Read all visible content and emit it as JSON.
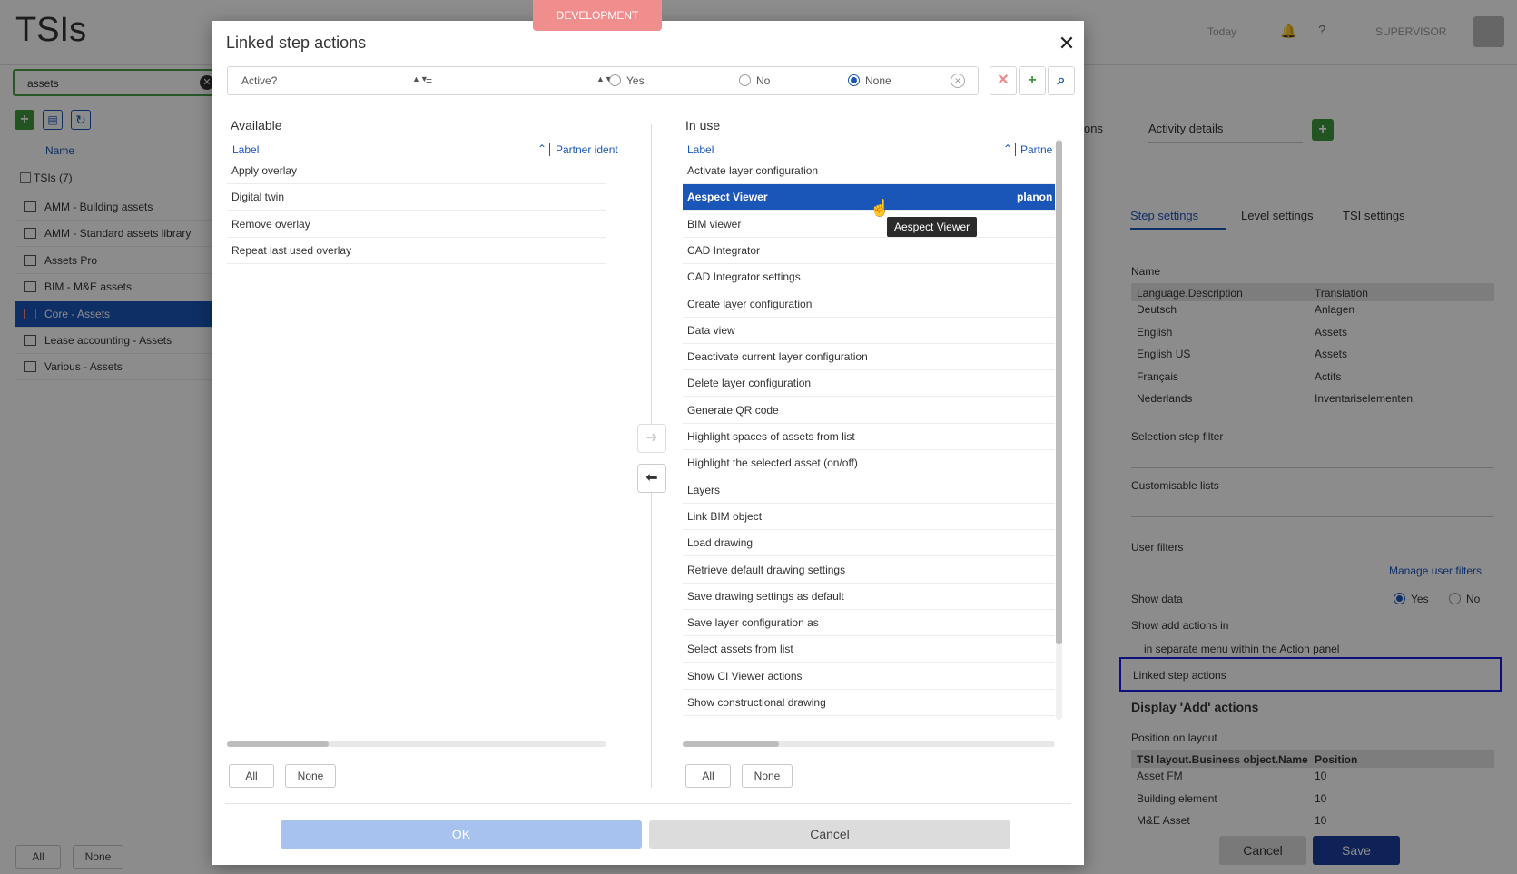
{
  "env_badge": "DEVELOPMENT",
  "app": {
    "title": "TSIs",
    "search_value": "assets",
    "list_header_name": "Name",
    "group_label": "TSIs (7)",
    "items": [
      {
        "label": "AMM - Building assets"
      },
      {
        "label": "AMM - Standard assets library"
      },
      {
        "label": "Assets Pro"
      },
      {
        "label": "BIM - M&E assets"
      },
      {
        "label": "Core - Assets",
        "selected": true
      },
      {
        "label": "Lease accounting - Assets"
      },
      {
        "label": "Various - Assets"
      }
    ],
    "bottom_all": "All",
    "bottom_none": "None",
    "top_right": {
      "today": "Today",
      "user": "SUPERVISOR"
    },
    "tabs_partial": "ons",
    "tab_activity": "Activity details",
    "settings_tabs": [
      "Step settings",
      "Level settings",
      "TSI settings"
    ],
    "name_label": "Name",
    "translation_table": {
      "headers": [
        "Language.Description",
        "Translation"
      ],
      "rows": [
        [
          "Deutsch",
          "Anlagen"
        ],
        [
          "English",
          "Assets"
        ],
        [
          "English US",
          "Assets"
        ],
        [
          "Français",
          "Actifs"
        ],
        [
          "Nederlands",
          "Inventariselementen"
        ]
      ]
    },
    "selection_filter": "Selection step filter",
    "custom_lists": "Customisable lists",
    "user_filters": "User filters",
    "manage_filters": "Manage user filters",
    "show_data": "Show data",
    "yes": "Yes",
    "no": "No",
    "show_add_actions": "Show add actions in",
    "add_actions_value": "in separate menu within the Action panel",
    "linked_step_actions": "Linked step actions",
    "display_add": "Display 'Add' actions",
    "position_on_layout": "Position on layout",
    "layout_table": {
      "headers": [
        "TSI layout.Business object.Name",
        "Position"
      ],
      "rows": [
        [
          "Asset FM",
          "10"
        ],
        [
          "Building element",
          "10"
        ],
        [
          "M&E Asset",
          "10"
        ]
      ]
    },
    "cancel": "Cancel",
    "save": "Save"
  },
  "dialog": {
    "title": "Linked step actions",
    "filter": {
      "field": "Active?",
      "operator": "=",
      "options": [
        "Yes",
        "No",
        "None"
      ],
      "selected": "None"
    },
    "available": {
      "title": "Available",
      "col_label": "Label",
      "col_partner": "Partner ident",
      "rows": [
        "Apply overlay",
        "Digital twin",
        "Remove overlay",
        "Repeat last used overlay"
      ],
      "all": "All",
      "none": "None"
    },
    "in_use": {
      "title": "In use",
      "col_label": "Label",
      "col_partner": "Partne",
      "rows": [
        {
          "label": "Activate layer configuration",
          "partner": ""
        },
        {
          "label": "Aespect Viewer",
          "partner": "planon",
          "selected": true
        },
        {
          "label": "BIM viewer",
          "partner": ""
        },
        {
          "label": "CAD Integrator",
          "partner": ""
        },
        {
          "label": "CAD Integrator settings",
          "partner": ""
        },
        {
          "label": "Create layer configuration",
          "partner": ""
        },
        {
          "label": "Data view",
          "partner": ""
        },
        {
          "label": "Deactivate current layer configuration",
          "partner": ""
        },
        {
          "label": "Delete layer configuration",
          "partner": ""
        },
        {
          "label": "Generate QR code",
          "partner": ""
        },
        {
          "label": "Highlight spaces of assets from list",
          "partner": ""
        },
        {
          "label": "Highlight the selected asset (on/off)",
          "partner": ""
        },
        {
          "label": "Layers",
          "partner": ""
        },
        {
          "label": "Link BIM object",
          "partner": ""
        },
        {
          "label": "Load drawing",
          "partner": ""
        },
        {
          "label": "Retrieve default drawing settings",
          "partner": ""
        },
        {
          "label": "Save drawing settings as default",
          "partner": ""
        },
        {
          "label": "Save layer configuration as",
          "partner": ""
        },
        {
          "label": "Select assets from list",
          "partner": ""
        },
        {
          "label": "Show CI Viewer actions",
          "partner": ""
        },
        {
          "label": "Show constructional drawing",
          "partner": ""
        }
      ],
      "all": "All",
      "none": "None"
    },
    "tooltip": "Aespect Viewer",
    "ok": "OK",
    "cancel": "Cancel"
  },
  "colors": {
    "accent": "#1a56b8",
    "add_green": "#3c9a3c",
    "dev_badge": "#f08d8d"
  }
}
